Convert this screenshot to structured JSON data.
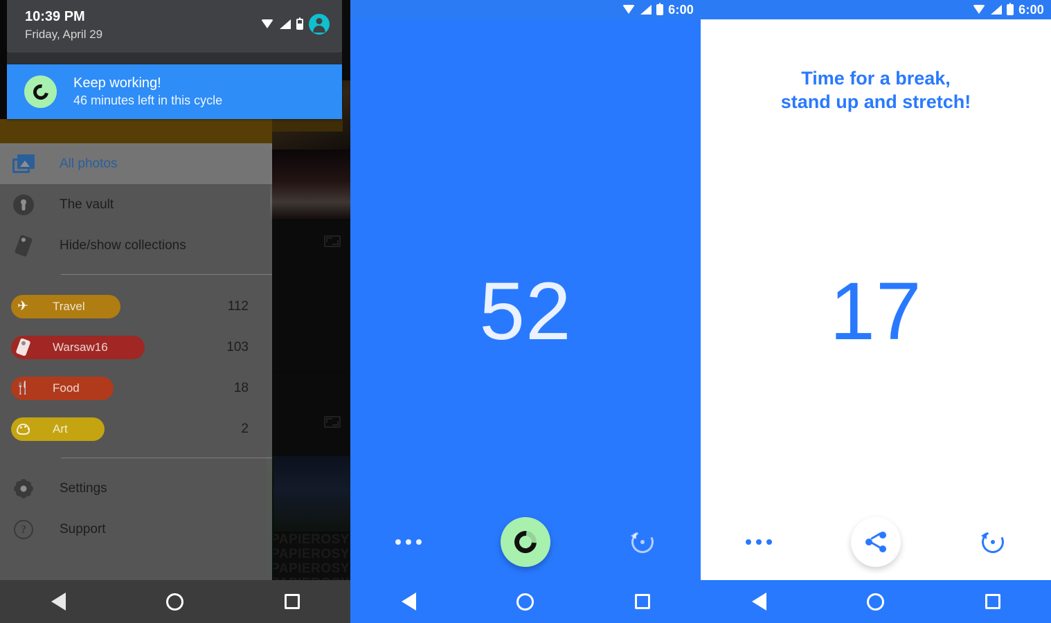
{
  "left_panel": {
    "status_shade": {
      "time": "10:39 PM",
      "date": "Friday, April 29",
      "icons": [
        "wifi-icon",
        "signal-icon",
        "battery-icon",
        "user-avatar-icon"
      ]
    },
    "notification": {
      "title": "Keep working!",
      "subtitle": "46 minutes left in this cycle",
      "icon": "timer-ring-icon",
      "background_color": "#2E8DF7",
      "icon_color": "#A8F0AE"
    },
    "drawer": {
      "items": [
        {
          "label": "All photos",
          "icon": "photos-icon",
          "active": true
        },
        {
          "label": "The vault",
          "icon": "lock-icon",
          "active": false
        },
        {
          "label": "Hide/show collections",
          "icon": "tag-icon",
          "active": false
        }
      ],
      "collections": [
        {
          "label": "Travel",
          "count": "112",
          "icon": "airplane-icon",
          "color": "#B07D12"
        },
        {
          "label": "Warsaw16",
          "count": "103",
          "icon": "tag-icon",
          "color": "#A02723"
        },
        {
          "label": "Food",
          "count": "18",
          "icon": "cutlery-icon",
          "color": "#B13A1C"
        },
        {
          "label": "Art",
          "count": "2",
          "icon": "palette-icon",
          "color": "#C4A411"
        }
      ],
      "footer_items": [
        {
          "label": "Settings",
          "icon": "gear-icon"
        },
        {
          "label": "Support",
          "icon": "help-circle-icon"
        }
      ]
    },
    "photo_wall_watermark": "PAPIEROSY",
    "navbar": {
      "back": "back-icon",
      "home": "home-icon",
      "recents": "recents-icon"
    }
  },
  "mid_panel": {
    "status_bar": {
      "time": "6:00",
      "icons": [
        "wifi-icon",
        "signal-icon",
        "battery-icon"
      ]
    },
    "count": "52",
    "background_color": "#2979FF",
    "actions": {
      "overflow": "more-options-icon",
      "primary": "timer-ring-icon",
      "restore": "restore-icon"
    },
    "navbar": {
      "back": "back-icon",
      "home": "home-icon",
      "recents": "recents-icon"
    }
  },
  "right_panel": {
    "status_bar": {
      "time": "6:00",
      "icons": [
        "wifi-icon",
        "signal-icon",
        "battery-icon"
      ]
    },
    "headline_line1": "Time for a break,",
    "headline_line2": "stand up and stretch!",
    "count": "17",
    "accent_color": "#2979FF",
    "actions": {
      "overflow": "more-options-icon",
      "primary": "share-icon",
      "restore": "restore-icon"
    },
    "navbar": {
      "back": "back-icon",
      "home": "home-icon",
      "recents": "recents-icon"
    }
  }
}
